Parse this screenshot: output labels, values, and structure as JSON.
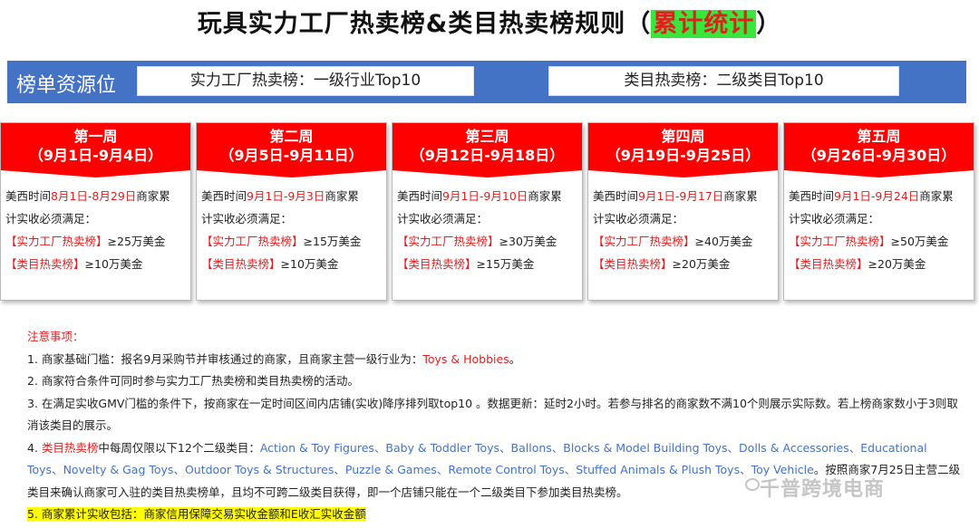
{
  "title": {
    "prefix": "玩具实力工厂热卖榜&类目热卖榜规则（",
    "highlight": "累计统计",
    "suffix": "）"
  },
  "banner": {
    "label": "榜单资源位",
    "factory": "实力工厂热卖榜：一级行业Top10",
    "category": "类目热卖榜：二级类目Top10"
  },
  "weeks": [
    {
      "name": "第一周",
      "dates": "（9月1日-9月4日）",
      "pre": "美西时间",
      "range": "8月1日-8月29日",
      "post1": "商家累",
      "post2": "计实收必须满足：",
      "factory_tag": "【实力工厂热卖榜】",
      "factory_amt": "≥25万美金",
      "cat_tag": "【类目热卖榜】",
      "cat_amt": "≥10万美金"
    },
    {
      "name": "第二周",
      "dates": "（9月5日-9月11日）",
      "pre": "美西时间",
      "range": "9月1日-9月3日",
      "post1": "商家累",
      "post2": "计实收必须满足：",
      "factory_tag": "【实力工厂热卖榜】",
      "factory_amt": "≥15万美金",
      "cat_tag": "【类目热卖榜】",
      "cat_amt": "≥10万美金"
    },
    {
      "name": "第三周",
      "dates": "（9月12日-9月18日）",
      "pre": "美西时间",
      "range": "9月1日-9月10日",
      "post1": "商家累",
      "post2": "计实收必须满足：",
      "factory_tag": "【实力工厂热卖榜】",
      "factory_amt": "≥30万美金",
      "cat_tag": "【类目热卖榜】",
      "cat_amt": "≥15万美金"
    },
    {
      "name": "第四周",
      "dates": "（9月19日-9月25日）",
      "pre": "美西时间",
      "range": "9月1日-9月17日",
      "post1": "商家累",
      "post2": "计实收必须满足：",
      "factory_tag": "【实力工厂热卖榜】",
      "factory_amt": "≥40万美金",
      "cat_tag": "【类目热卖榜】",
      "cat_amt": "≥20万美金"
    },
    {
      "name": "第五周",
      "dates": "（9月26日-9月30日）",
      "pre": "美西时间",
      "range": "9月1日-9月24日",
      "post1": "商家累",
      "post2": "计实收必须满足：",
      "factory_tag": "【实力工厂热卖榜】",
      "factory_amt": "≥50万美金",
      "cat_tag": "【类目热卖榜】",
      "cat_amt": "≥20万美金"
    }
  ],
  "notes": {
    "heading": "注意事项：",
    "n1_pre": "1. 商家基础门槛：报名9月采购节并审核通过的商家，且商家主营一级行业为：",
    "n1_red": "Toys & Hobbies",
    "n1_post": "。",
    "n2": "2. 商家符合条件可同时参与实力工厂热卖榜和类目热卖榜的活动。",
    "n3": "3. 在满足实收GMV门槛的条件下，按商家在一定时间区间内店铺(实收)降序排列取top10 。数据更新：延时2小时。若参与排名的商家数不满10个则展示实际数。若上榜商家数小于3则取消该类目的展示。",
    "n4_num": "4. ",
    "n4_red": "类目热卖榜",
    "n4_mid": "中每周仅限以下12个二级类目：",
    "n4_blue": "Action & Toy Figures、Baby & Toddler Toys、Ballons、Blocks & Model Building Toys、Dolls & Accessories、Educational Toys、Novelty & Gag Toys、Outdoor Toys & Structures、Puzzle & Games、Remote Control Toys、Stuffed Animals & Plush Toys、Toy Vehicle",
    "n4_post": "。按照商家7月25日主营二级类目来确认商家可入驻的类目热卖榜单，且均不可跨二级类目获得，即一个店铺只能在一个二级类目下参加类目热卖榜。",
    "n5": "5. 商家累计实收包括：商家信用保障交易实收金额和E收汇实收金额"
  },
  "watermark": "千普跨境电商"
}
